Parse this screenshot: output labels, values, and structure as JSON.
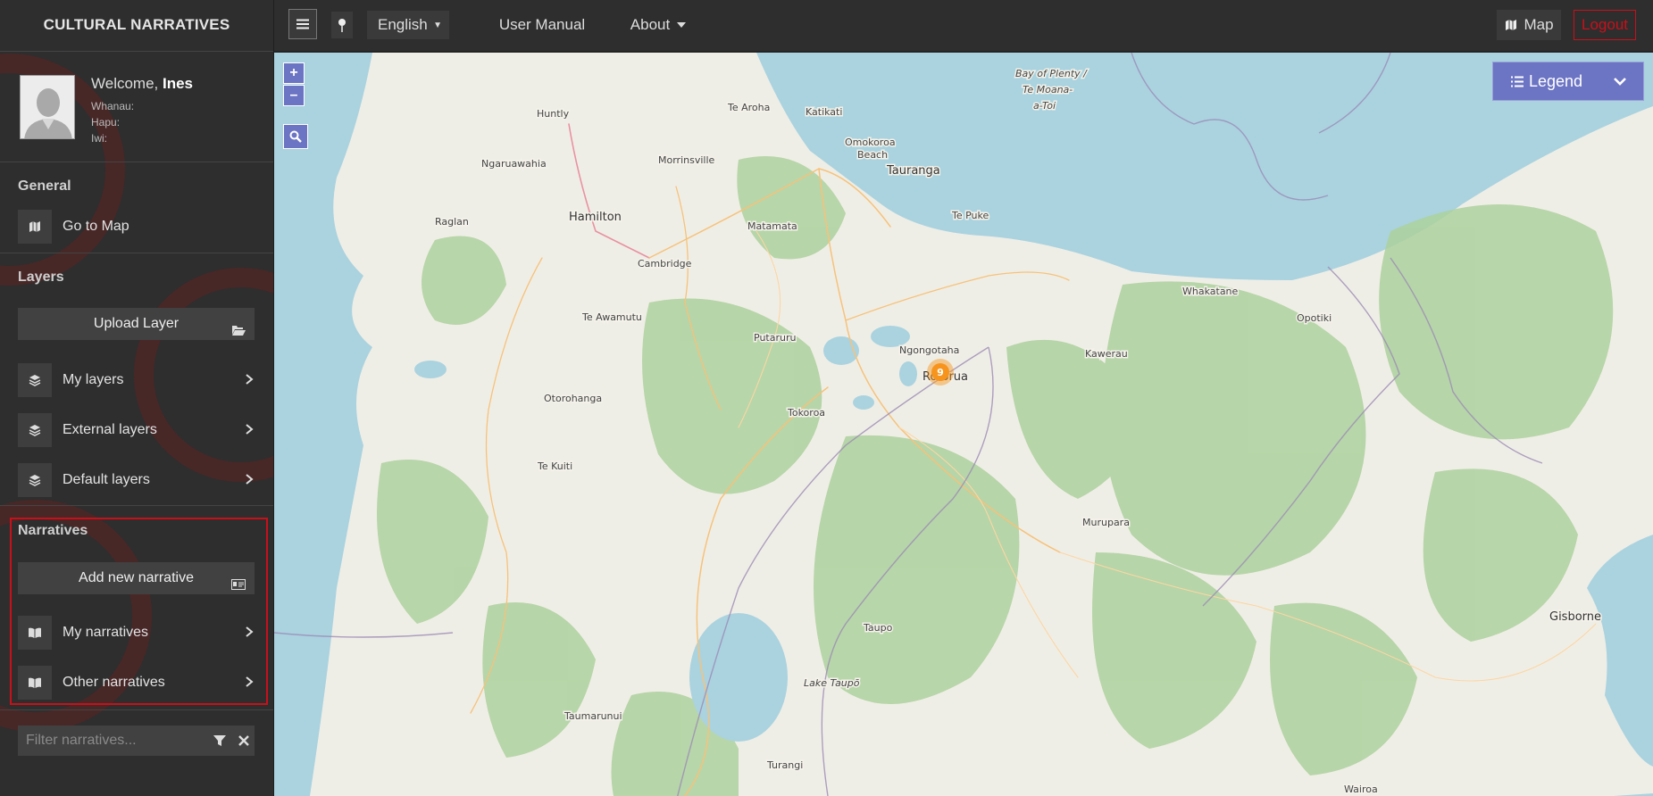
{
  "app": {
    "title": "CULTURAL NARRATIVES"
  },
  "user": {
    "welcome_prefix": "Welcome,",
    "name": "Ines",
    "whanau_label": "Whanau:",
    "hapu_label": "Hapu:",
    "iwi_label": "Iwi:"
  },
  "sidebar": {
    "general": {
      "heading": "General",
      "go_to_map": "Go to Map"
    },
    "layers": {
      "heading": "Layers",
      "upload": "Upload Layer",
      "items": [
        "My layers",
        "External layers",
        "Default layers"
      ]
    },
    "narratives": {
      "heading": "Narratives",
      "add": "Add new narrative",
      "items": [
        "My narratives",
        "Other narratives"
      ]
    },
    "filter": {
      "placeholder": "Filter narratives..."
    }
  },
  "topbar": {
    "language": "English",
    "user_manual": "User Manual",
    "about": "About",
    "map": "Map",
    "logout": "Logout"
  },
  "map": {
    "legend": "Legend",
    "zoom_in": "+",
    "zoom_out": "–",
    "cluster_count": "9",
    "places": {
      "bay": [
        "Bay of Plenty /",
        "Te Moana-",
        "a-Toi"
      ],
      "huntly": "Huntly",
      "te_aroha": "Te Aroha",
      "katikati": "Katikati",
      "ngaruawahia": "Ngaruawahia",
      "morrinsville": "Morrinsville",
      "omokoroa": "Omokoroa",
      "beach": "Beach",
      "tauranga": "Tauranga",
      "raglan": "Raglan",
      "hamilton": "Hamilton",
      "matamata": "Matamata",
      "te_puke": "Te Puke",
      "cambridge": "Cambridge",
      "whakatane": "Whakatane",
      "te_awamutu": "Te Awamutu",
      "opotiki": "Opotiki",
      "putaruru": "Putaruru",
      "ngongotaha": "Ngongotaha",
      "rotorua": "Rotorua",
      "kawerau": "Kawerau",
      "otorohanga": "Otorohanga",
      "tokoroa": "Tokoroa",
      "te_kuiti": "Te Kuiti",
      "murupara": "Murupara",
      "taupo": "Taupo",
      "lake_taupo": "Lake Taupō",
      "gisborne": "Gisborne",
      "taumarunui": "Taumarunui",
      "turangi": "Turangi",
      "wairoa": "Wairoa"
    }
  },
  "colors": {
    "accent": "#6c74c4",
    "logout": "#c8101a",
    "cluster": "#f7941d"
  }
}
